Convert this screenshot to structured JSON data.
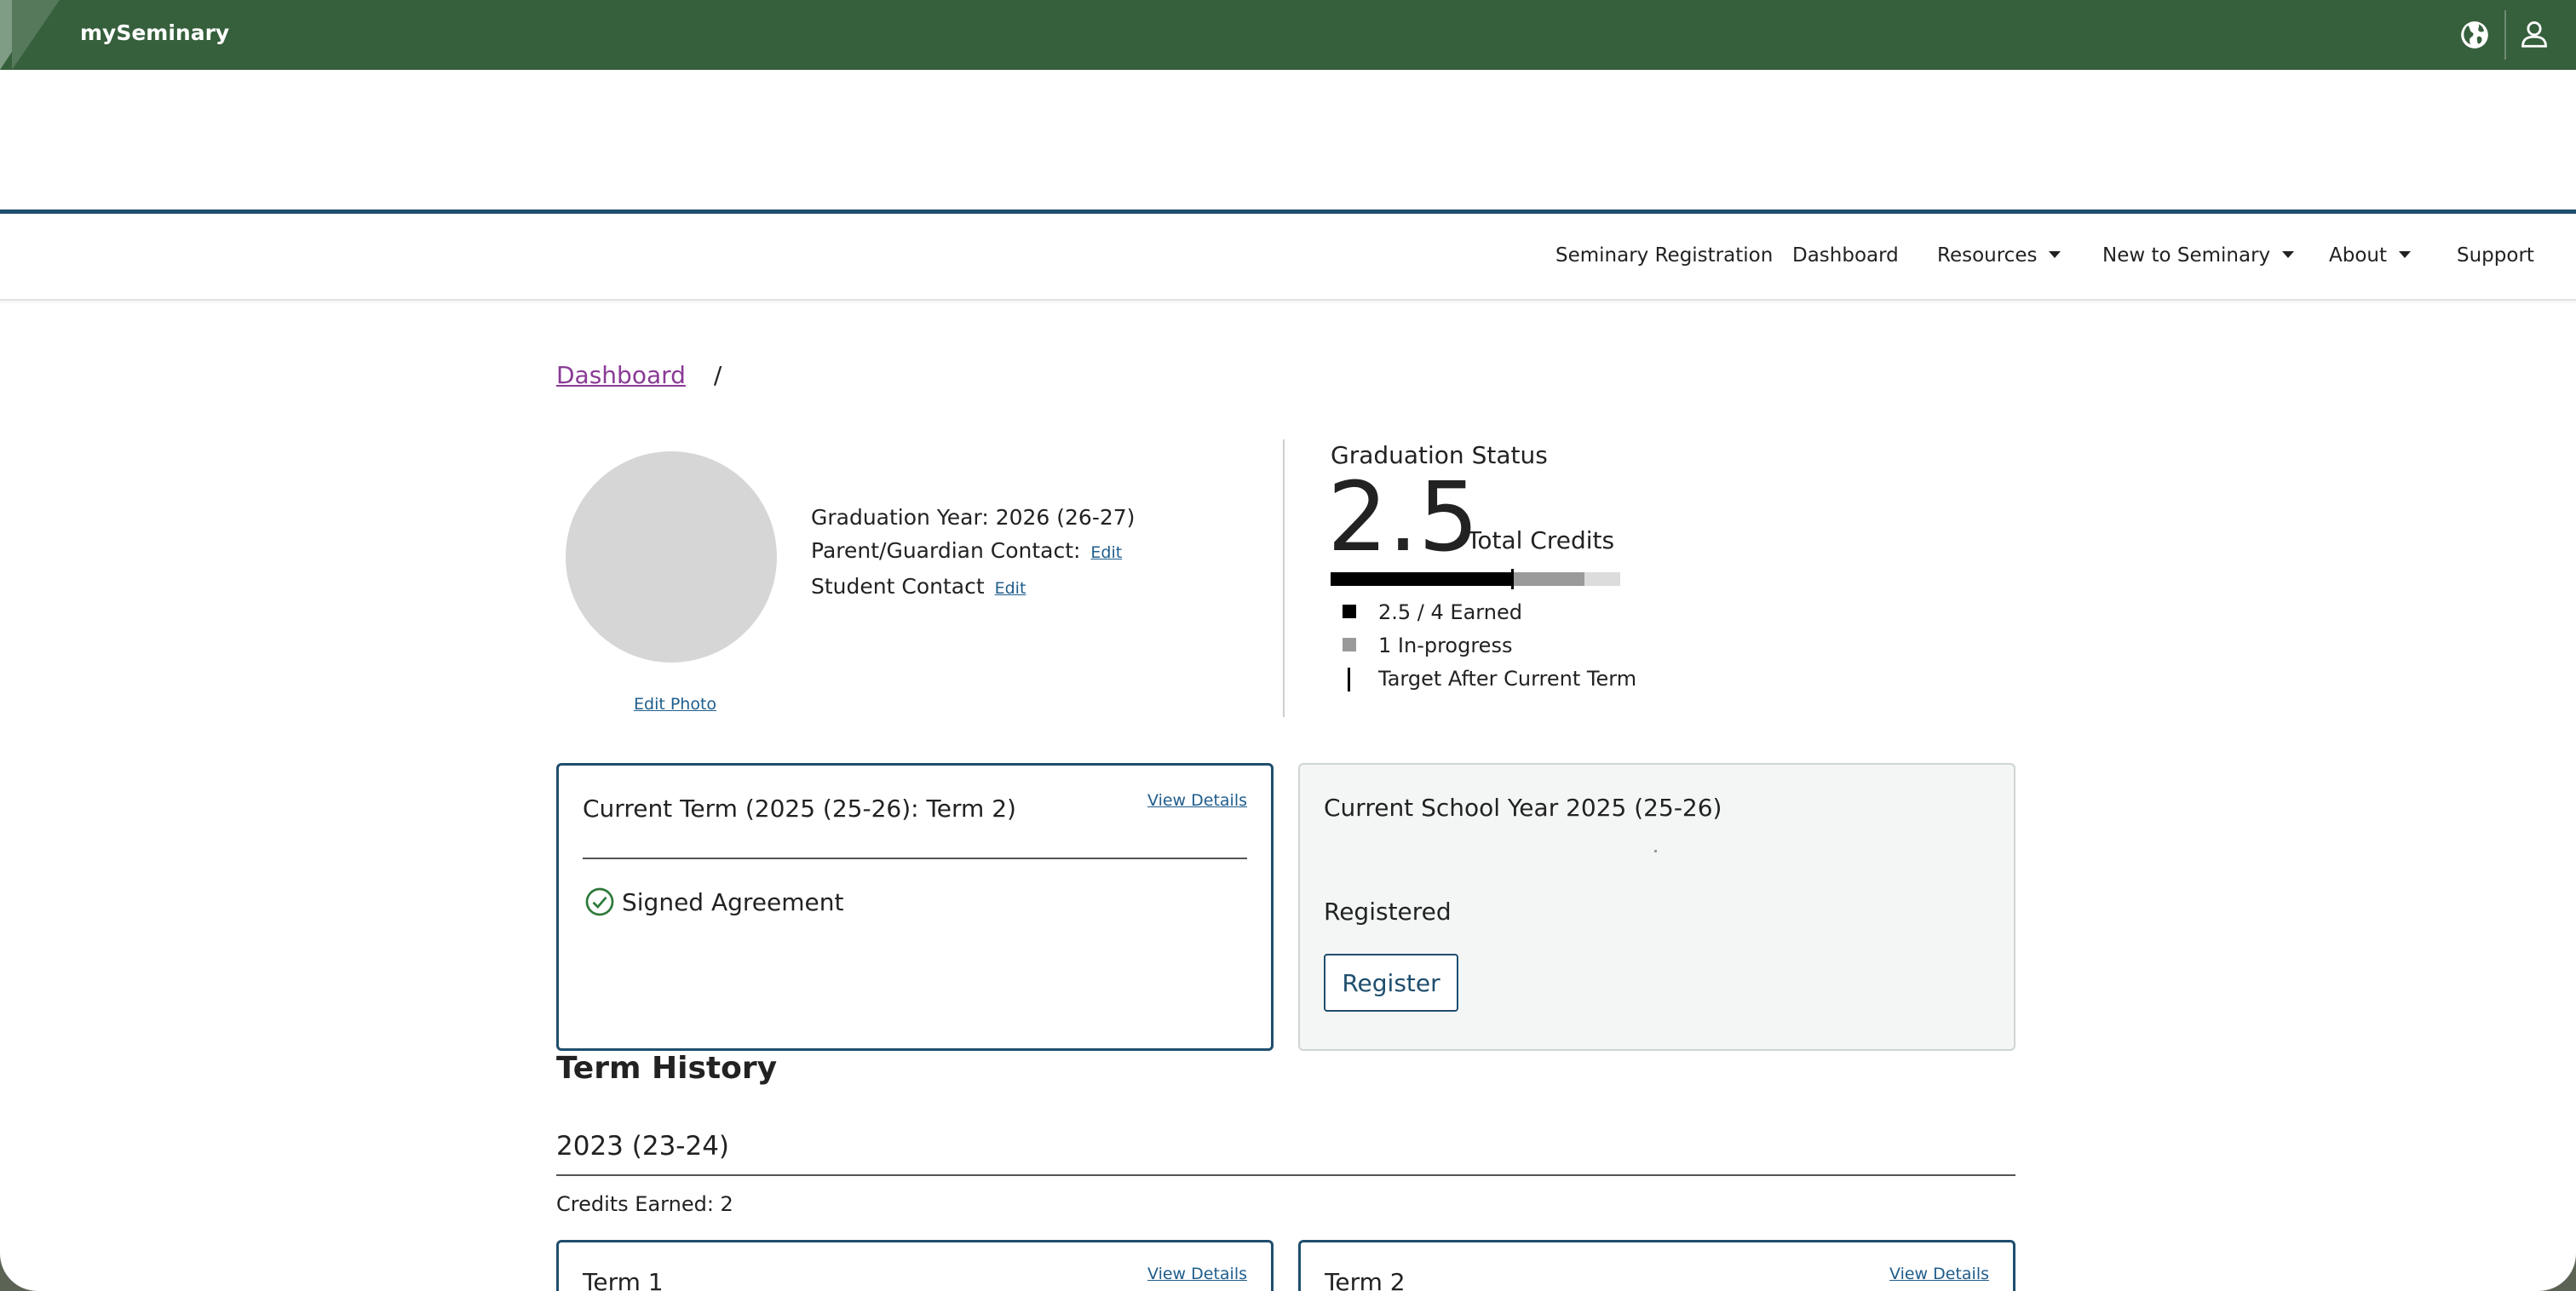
{
  "app": {
    "brand": "mySeminary"
  },
  "nav": {
    "items": [
      {
        "label": "Seminary Registration",
        "dropdown": false
      },
      {
        "label": "Dashboard",
        "dropdown": false
      },
      {
        "label": "Resources",
        "dropdown": true
      },
      {
        "label": "New to Seminary",
        "dropdown": true
      },
      {
        "label": "About",
        "dropdown": true
      },
      {
        "label": "Support",
        "dropdown": false
      }
    ]
  },
  "breadcrumb": {
    "root": "Dashboard",
    "separator": "/"
  },
  "profile": {
    "graduation_year": "Graduation Year: 2026 (26-27)",
    "parent_contact_label": "Parent/Guardian Contact:",
    "student_contact_label": "Student Contact",
    "edit_label": "Edit",
    "edit_photo": "Edit Photo"
  },
  "graduation": {
    "title": "Graduation Status",
    "total": "2.5",
    "total_label": "Total Credits",
    "earned": 2.5,
    "in_progress": 1,
    "required": 4,
    "target_after_term": 3.5,
    "legend_earned": "2.5 / 4 Earned",
    "legend_in_progress": "1 In-progress",
    "legend_target": "Target After Current Term",
    "colors": {
      "earned": "#000000",
      "in_progress": "#9a9a9a",
      "remaining": "#dcdcdc"
    }
  },
  "current_term": {
    "title": "Current Term (2025 (25-26): Term 2)",
    "view_details": "View Details",
    "status": "Signed Agreement"
  },
  "current_year": {
    "title": "Current School Year 2025 (25-26)",
    "status": "Registered",
    "register_button": "Register"
  },
  "term_history": {
    "heading": "Term History",
    "years": [
      {
        "label": "2023 (23-24)",
        "credits": "Credits Earned: 2",
        "terms": [
          {
            "title": "Term 1",
            "view_details": "View Details"
          },
          {
            "title": "Term 2",
            "view_details": "View Details"
          }
        ]
      }
    ]
  },
  "theme": {
    "header_green": "#365f3c",
    "accent_blue": "#1f4e6e",
    "link_purple": "#8a3a96"
  }
}
